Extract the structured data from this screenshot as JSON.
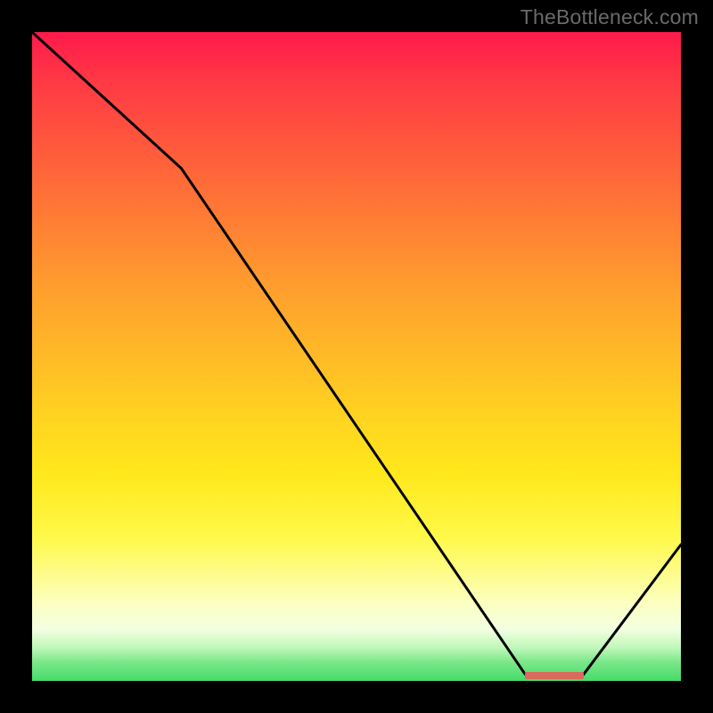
{
  "attribution": "TheBottleneck.com",
  "colors": {
    "page_bg": "#000000",
    "line": "#000000",
    "marker": "#d96a5c",
    "attribution_text": "#6a6a6a"
  },
  "chart_data": {
    "type": "line",
    "title": "",
    "xlabel": "",
    "ylabel": "",
    "xlim": [
      0,
      100
    ],
    "ylim": [
      0,
      100
    ],
    "x": [
      0,
      23,
      76,
      85,
      100
    ],
    "values": [
      100,
      79,
      1,
      1,
      21
    ],
    "marker_band": {
      "x_start": 76,
      "x_end": 85,
      "y": 0.8
    },
    "background_gradient": "red-yellow-green vertical gradient"
  }
}
